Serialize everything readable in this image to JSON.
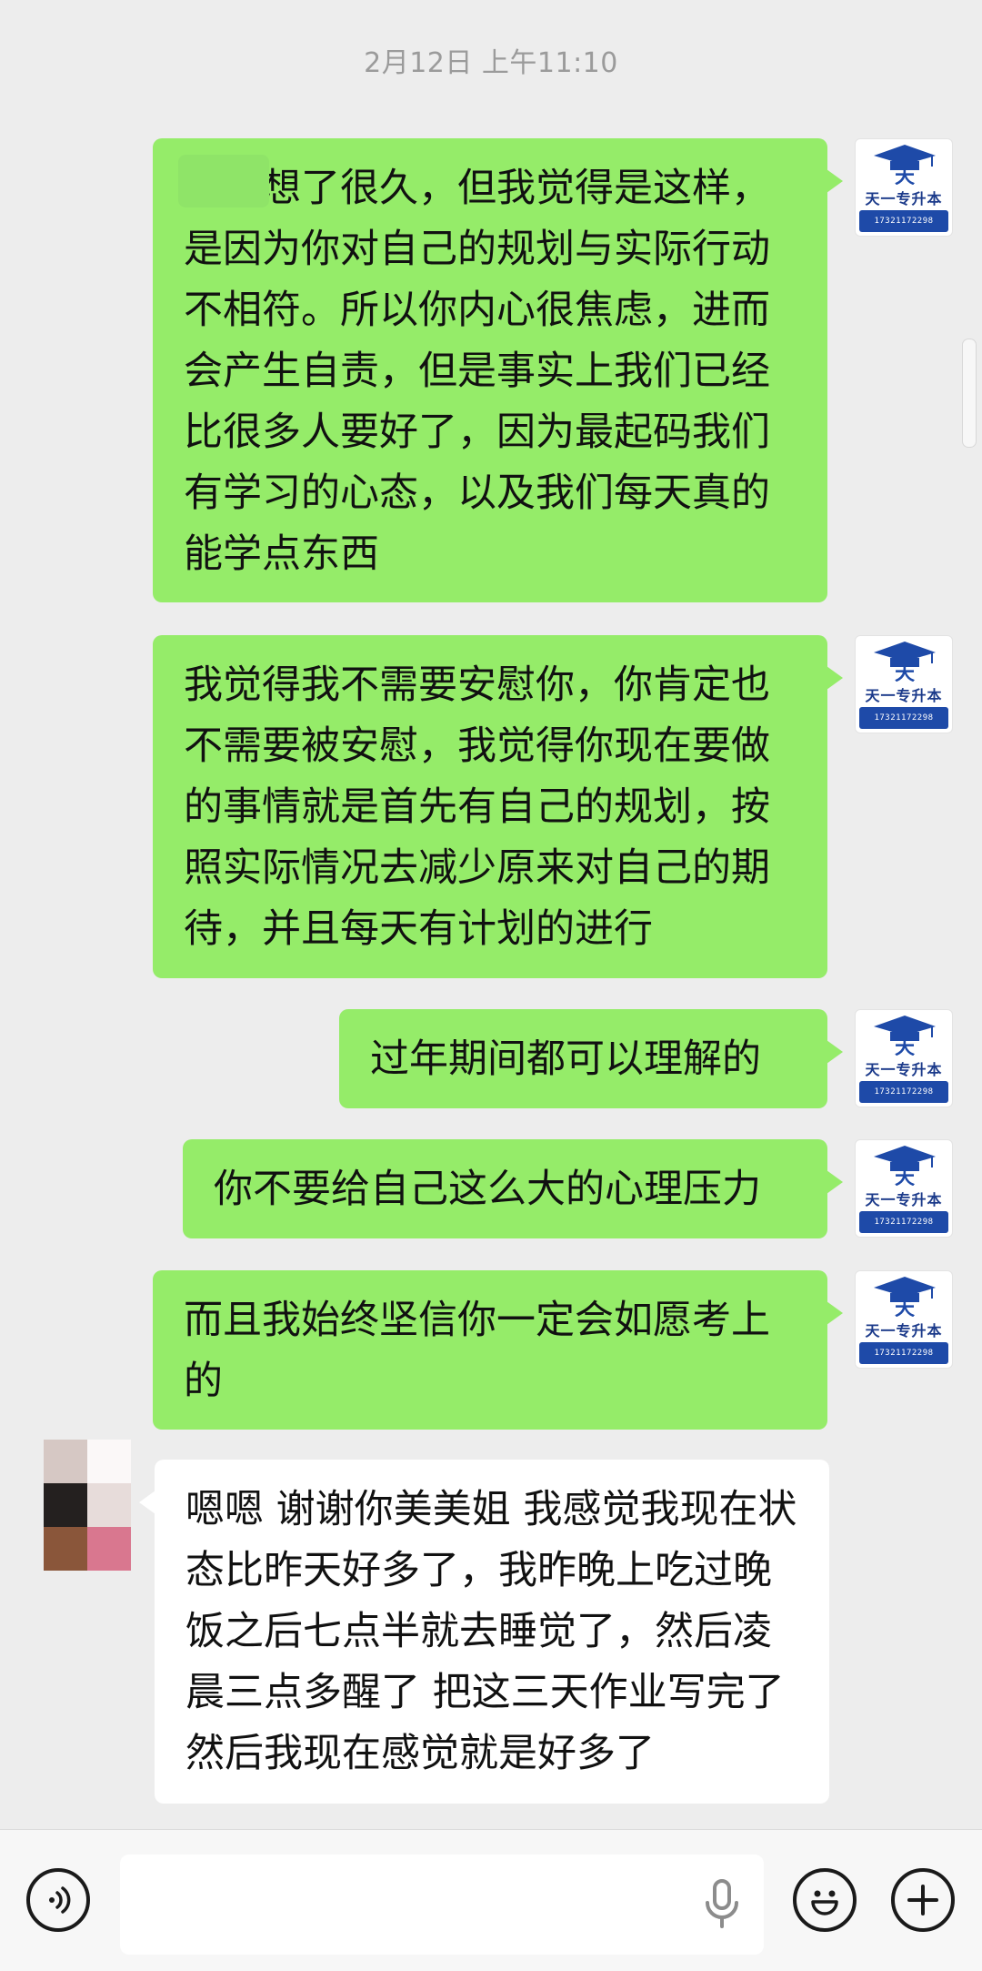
{
  "chat": {
    "timestamp": "2月12日 上午11:10",
    "messages": [
      {
        "direction": "out",
        "text": "，我想了很久，但我觉得是这样，是因为你对自己的规划与实际行动不相符。所以你内心很焦虑，进而会产生自责，但是事实上我们已经比很多人要好了，因为最起码我们有学习的心态，以及我们每天真的能学点东西"
      },
      {
        "direction": "out",
        "text": "我觉得我不需要安慰你，你肯定也不需要被安慰，我觉得你现在要做的事情就是首先有自己的规划，按照实际情况去减少原来对自己的期待，并且每天有计划的进行"
      },
      {
        "direction": "out",
        "text": "过年期间都可以理解的"
      },
      {
        "direction": "out",
        "text": "你不要给自己这么大的心理压力"
      },
      {
        "direction": "out",
        "text": "而且我始终坚信你一定会如愿考上的"
      },
      {
        "direction": "in",
        "text": "嗯嗯 谢谢你美美姐 我感觉我现在状态比昨天好多了，我昨晚上吃过晚饭之后七点半就去睡觉了，然后凌晨三点多醒了 把这三天作业写完了 然后我现在感觉就是好多了"
      }
    ]
  },
  "sender_avatar": {
    "name": "天一专升本",
    "phone": "17321172298",
    "colors": {
      "brand_blue": "#1e4aa8",
      "bubble_green": "#95ec69"
    }
  },
  "input_bar": {
    "value": "",
    "icons": [
      "voice-mode-icon",
      "microphone-icon",
      "emoji-icon",
      "plus-icon"
    ]
  }
}
